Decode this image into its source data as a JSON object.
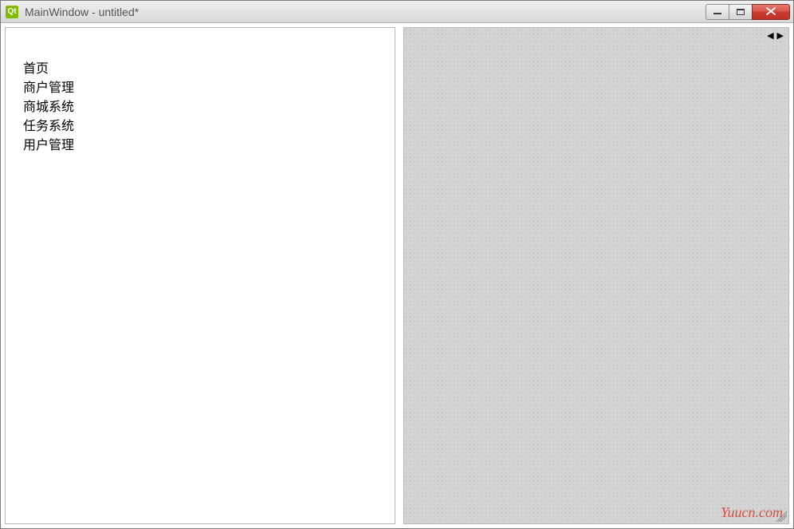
{
  "window": {
    "title": "MainWindow - untitled*",
    "icon_label": "Qt"
  },
  "tree": {
    "items": [
      {
        "label": "首页"
      },
      {
        "label": "商户管理"
      },
      {
        "label": "商城系统"
      },
      {
        "label": "任务系统"
      },
      {
        "label": "用户管理"
      }
    ]
  },
  "nav": {
    "left": "◀",
    "right": "▶"
  },
  "watermark": "Yuucn.com"
}
